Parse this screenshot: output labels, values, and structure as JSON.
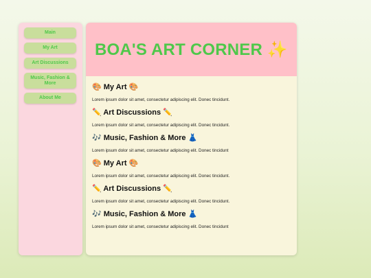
{
  "sidebar": {
    "items": [
      {
        "label": "Main"
      },
      {
        "label": "My Art"
      },
      {
        "label": "Art Discussions"
      },
      {
        "label": "Music, Fashion & More"
      },
      {
        "label": "About Me"
      }
    ]
  },
  "header": {
    "title": "BOA'S ART CORNER ✨"
  },
  "sections": [
    {
      "heading": "🎨 My Art 🎨",
      "text": "Lorem ipsum dolor sit amet, consectetur adipiscing elit. Donec tincidunt."
    },
    {
      "heading": "✏️ Art Discussions ✏️",
      "text": "Lorem ipsum dolor sit amet, consectetur adipiscing elit. Donec tincidunt."
    },
    {
      "heading": "🎶 Music, Fashion & More 👗",
      "text": "Lorem ipsum dolor sit amet, consectetur adipiscing elit. Donec tincidunt"
    },
    {
      "heading": "🎨 My Art 🎨",
      "text": "Lorem ipsum dolor sit amet, consectetur adipiscing elit. Donec tincidunt."
    },
    {
      "heading": "✏️ Art Discussions ✏️",
      "text": "Lorem ipsum dolor sit amet, consectetur adipiscing elit. Donec tincidunt."
    },
    {
      "heading": "🎶 Music, Fashion & More 👗",
      "text": "Lorem ipsum dolor sit amet, consectetur adipiscing elit. Donec tincidunt"
    }
  ],
  "colors": {
    "accent_green": "#4fc84a",
    "nav_button": "#c9de9c",
    "sidebar_bg": "#fbd7df",
    "banner_bg": "#ffc0c8",
    "content_bg": "#f9f5dc"
  }
}
